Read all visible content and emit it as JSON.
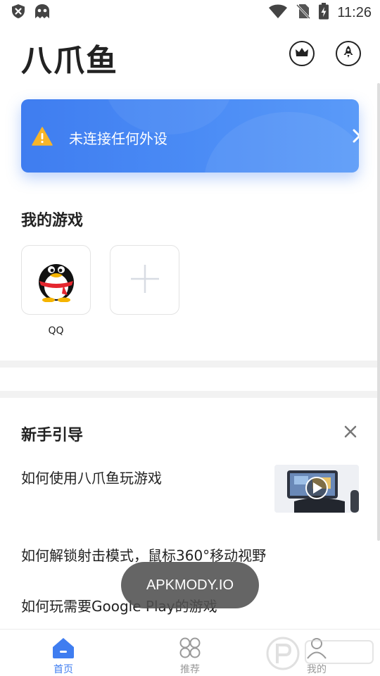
{
  "status_bar": {
    "time": "11:26"
  },
  "header": {
    "title": "八爪鱼"
  },
  "banner": {
    "text": "未连接任何外设"
  },
  "my_games": {
    "title": "我的游戏",
    "games": [
      {
        "label": "QQ"
      }
    ]
  },
  "guide": {
    "title": "新手引导",
    "items": [
      {
        "label": "如何使用八爪鱼玩游戏"
      },
      {
        "label": "如何解锁射击模式，鼠标360°移动视野"
      },
      {
        "label": "如何玩需要Google Play的游戏"
      }
    ]
  },
  "toast": {
    "text": "APKMODY.IO"
  },
  "bottom_nav": {
    "items": [
      {
        "label": "首页",
        "active": true
      },
      {
        "label": "推荐",
        "active": false
      },
      {
        "label": "我的",
        "active": false
      }
    ]
  },
  "colors": {
    "accent": "#3f7df0",
    "inactive": "#9a9a9a"
  }
}
